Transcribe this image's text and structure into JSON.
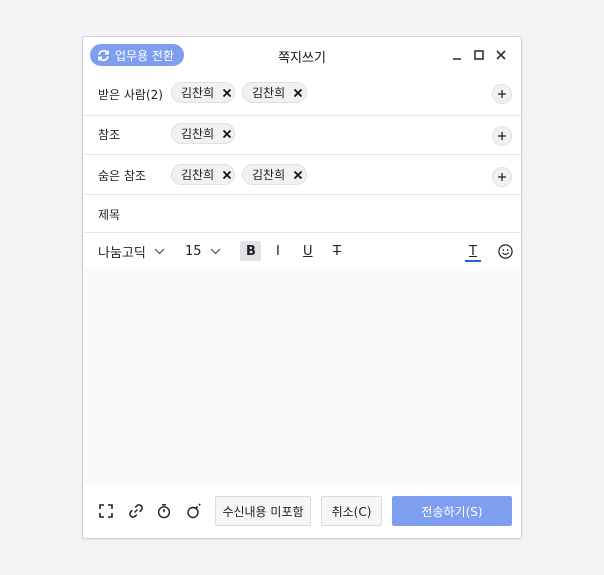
{
  "window": {
    "title": "쪽지쓰기",
    "switch_label": "업무용 전환"
  },
  "recipients": {
    "to_label": "받은 사람(2)",
    "to": [
      "김찬희",
      "김찬희"
    ],
    "cc_label": "참조",
    "cc": [
      "김찬희"
    ],
    "bcc_label": "숨은 참조",
    "bcc": [
      "김찬희",
      "김찬희"
    ],
    "subject_label": "제목"
  },
  "format_toolbar": {
    "font_family": "나눔고딕",
    "font_size": "15",
    "bold": "B",
    "italic": "I",
    "underline": "U",
    "strike": "T",
    "text_color": "T",
    "text_color_value": "#2d5fd1"
  },
  "footer": {
    "exclude_button": "수신내용 미포함",
    "cancel_button": "취소(C)",
    "send_button": "전송하기(S)"
  },
  "colors": {
    "accent": "#7e9ff0"
  }
}
